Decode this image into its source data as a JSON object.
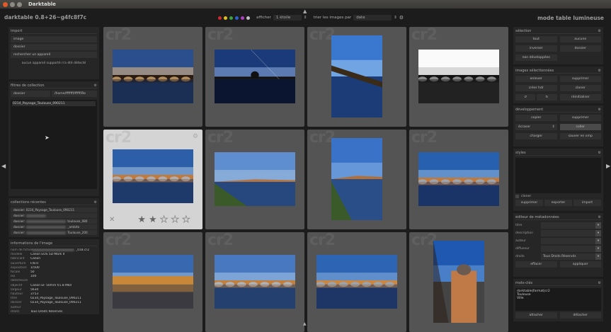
{
  "window": {
    "title": "Darktable"
  },
  "header": {
    "app_version": "darktable 0.8+26~g4fc8f7c",
    "mode": "mode table lumineuse",
    "filter": {
      "colors": [
        "#d02a2a",
        "#e0c020",
        "#3aa040",
        "#3060d0",
        "#b040c0",
        "#c0c0c0"
      ],
      "show_label": "afficher",
      "show_value": "1 étoile",
      "sort_label": "trier les images par",
      "sort_value": "date"
    }
  },
  "left": {
    "import": {
      "title": "import",
      "buttons": [
        "image",
        "dossier",
        "rechercher un appareil"
      ],
      "note": "aucun appareil supporté n'a été détecté"
    },
    "collection": {
      "title": "filtres de collection",
      "property": "dossier",
      "value": "/home/fffffff/fffff/Re",
      "items": [
        "0214_Paysage_Toulouse_090211"
      ]
    },
    "recent": {
      "title": "collections récentes",
      "items": [
        {
          "prefix": "dossier: 0234_Paysage_Toulouse_090211",
          "suffix": ""
        },
        {
          "prefix": "dossier:",
          "suffix": ""
        },
        {
          "prefix": "dossier:",
          "suffix": "toulouse_080"
        },
        {
          "prefix": "dossier:",
          "suffix": "_ambito"
        },
        {
          "prefix": "dossier:",
          "suffix": "Toulouse_200"
        }
      ]
    },
    "info": {
      "title": "informations de l'image",
      "rows": [
        {
          "k": "nom de fichier",
          "v": "_018.cr2"
        },
        {
          "k": "modèle",
          "v": "Canon EOS 5D Mark II"
        },
        {
          "k": "fabricant",
          "v": "Canon"
        },
        {
          "k": "ouverture",
          "v": "F/8.0"
        },
        {
          "k": "exposition",
          "v": "1/500"
        },
        {
          "k": "focale",
          "v": "50"
        },
        {
          "k": "iso",
          "v": "100"
        },
        {
          "k": "date/heure",
          "v": ""
        },
        {
          "k": "objectif",
          "v": "Canon EF 50mm f/1.8 MkII"
        },
        {
          "k": "largeur",
          "v": "5634"
        },
        {
          "k": "hauteur",
          "v": "3753"
        },
        {
          "k": "titre",
          "v": "0234_Paysage_Toulouse_090211"
        },
        {
          "k": "dossier",
          "v": "0234_Paysage_Toulouse_090211"
        },
        {
          "k": "auteur",
          "v": ""
        },
        {
          "k": "droits",
          "v": "Tous Droits Réservés"
        }
      ]
    }
  },
  "right": {
    "selection": {
      "title": "sélection",
      "buttons": [
        "tout",
        "aucune",
        "inverser",
        "dossier",
        "non développées"
      ]
    },
    "images": {
      "title": "images sélectionnées",
      "buttons": [
        "enlever",
        "supprimer",
        "créer hdr",
        "cloner",
        "↺",
        "↻",
        "réinitialiser"
      ]
    },
    "dev": {
      "title": "développement",
      "buttons": [
        "copier",
        "supprimer",
        "coller",
        "charger",
        "sauver en xmp"
      ],
      "select": "écraser"
    },
    "styles": {
      "title": "styles",
      "clone_label": "cloner",
      "buttons": [
        "supprimer",
        "exporter",
        "import"
      ]
    },
    "meta": {
      "title": "éditeur de métadonnées",
      "fields": [
        {
          "label": "titre",
          "value": ""
        },
        {
          "label": "description",
          "value": ""
        },
        {
          "label": "auteur",
          "value": ""
        },
        {
          "label": "diffuseur",
          "value": ""
        },
        {
          "label": "droits",
          "value": "Tous Droits Réservés"
        }
      ],
      "buttons": [
        "effacer",
        "appliquer"
      ]
    },
    "tags": {
      "title": "mots-clés",
      "items": [
        "darktable|format|cr2",
        "Toulouse",
        "Ville"
      ],
      "buttons": [
        "attacher",
        "détacher"
      ]
    }
  },
  "thumbs": {
    "watermark": "cr2",
    "reject": "✕",
    "star": "★",
    "rating": 2,
    "max_stars": 5
  }
}
